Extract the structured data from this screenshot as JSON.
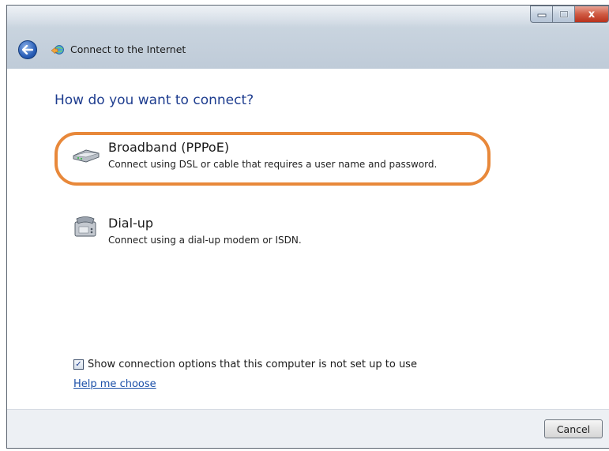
{
  "window": {
    "title": "Connect to the Internet",
    "controls": {
      "minimize_icon": "minimize-icon",
      "maximize_icon": "maximize-icon",
      "close_label": "x"
    }
  },
  "heading": "How do you want to connect?",
  "options": [
    {
      "title": "Broadband (PPPoE)",
      "description": "Connect using DSL or cable that requires a user name and password.",
      "icon": "broadband-modem-icon",
      "highlighted": true
    },
    {
      "title": "Dial-up",
      "description": "Connect using a dial-up modem or ISDN.",
      "icon": "dialup-modem-icon",
      "highlighted": false
    }
  ],
  "show_options_checkbox": {
    "label": "Show connection options that this computer is not set up to use",
    "checked": true
  },
  "help_link": "Help me choose",
  "footer": {
    "cancel_label": "Cancel"
  },
  "colors": {
    "heading": "#1e3d8f",
    "highlight": "#e8883a",
    "link": "#1a4fa8",
    "close_button": "#cf5a43"
  }
}
